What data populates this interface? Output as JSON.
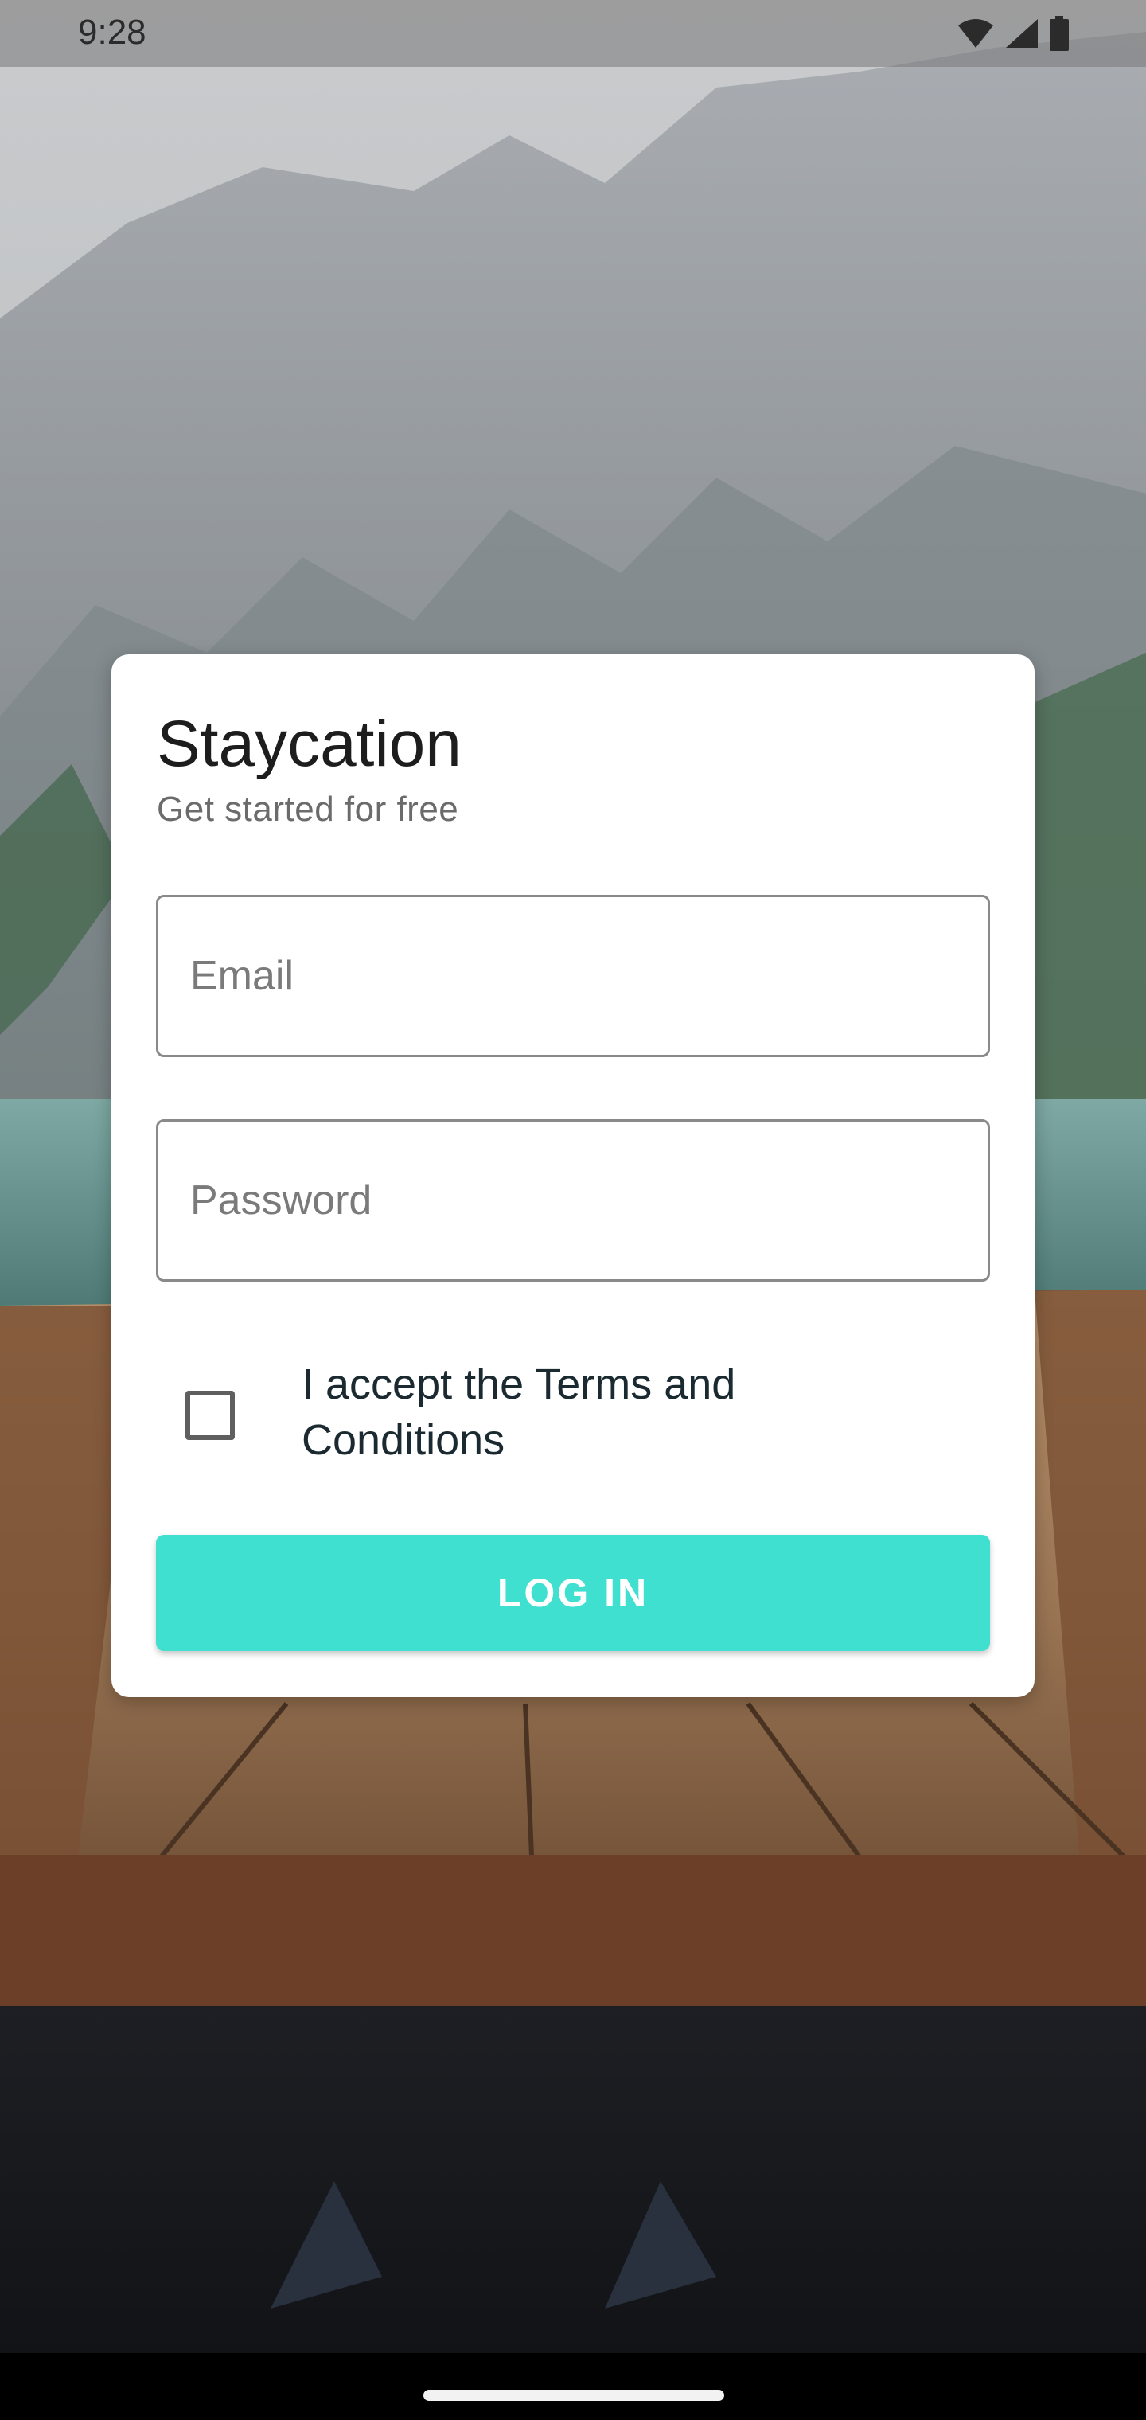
{
  "status_bar": {
    "time": "9:28",
    "icons": [
      "wifi-icon",
      "signal-icon",
      "battery-icon"
    ]
  },
  "card": {
    "title": "Staycation",
    "subtitle": "Get started for free",
    "email_field": {
      "placeholder": "Email",
      "value": ""
    },
    "password_field": {
      "placeholder": "Password",
      "value": ""
    },
    "terms": {
      "checked": false,
      "label": "I accept the Terms and Conditions"
    },
    "login_button": {
      "label": "LOG IN"
    }
  },
  "colors": {
    "accent": "#40E0D0",
    "card_background": "#FFFFFF",
    "title_text": "#1D1D1D",
    "nav_bar": "#000000"
  }
}
